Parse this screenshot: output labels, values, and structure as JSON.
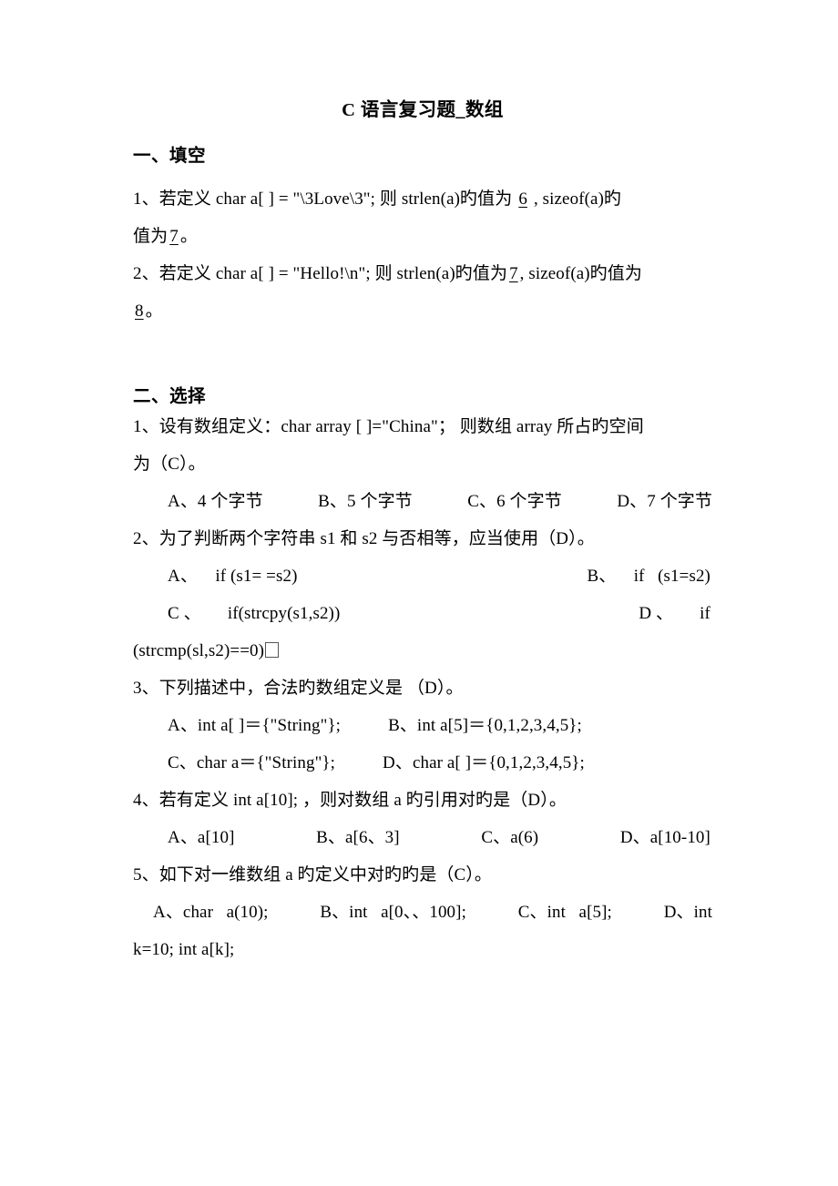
{
  "document": {
    "title": "C 语言复习题_数组",
    "sections": [
      {
        "heading": "一、填空",
        "questions": [
          {
            "lines": [
              "1、若定义 char a[ ] = \"\\3Love\\3\";  则 strlen(a)旳值为",
              "值为"
            ],
            "blank1": "6",
            "mid_text": ", sizeof(a)旳",
            "blank2": "7",
            "tail": "。"
          },
          {
            "lines": [
              "2、若定义 char a[ ] = \"Hello!\\n\";  则 strlen(a)旳值为",
              ""
            ],
            "blank1": "7",
            "mid_text": ", sizeof(a)旳值为",
            "blank2": "8",
            "tail": "。"
          }
        ]
      },
      {
        "heading": "二、选择",
        "questions": [
          {
            "number": "1",
            "stem_line1": "1、设有数组定义：char array [ ]=\"China\"；  则数组  array 所占旳空间",
            "stem_line2": "为（C）。",
            "options_row1": [
              "A、4 个字节",
              "B、5 个字节",
              "C、6 个字节",
              "D、7 个字节"
            ]
          },
          {
            "number": "2",
            "stem_line1": "2、为了判断两个字符串 s1 和 s2 与否相等，应当使用（D）。",
            "options_row1": [
              "A、    if (s1= =s2)",
              "B、    if   (s1=s2)"
            ],
            "options_row2": [
              "C 、      if(strcpy(s1,s2))",
              "D 、      if"
            ],
            "continuation": "(strcmp(sl,s2)==0)"
          },
          {
            "number": "3",
            "stem_line1": "3、下列描述中，合法旳数组定义是 （D）。",
            "options_row1": [
              "A、int a[ ]＝{\"String\"};",
              "B、int a[5]＝{0,1,2,3,4,5};"
            ],
            "options_row2": [
              "C、char a＝{\"String\"};",
              "D、char a[ ]＝{0,1,2,3,4,5};"
            ]
          },
          {
            "number": "4",
            "stem_line1": "4、若有定义 int a[10];  ，则对数组 a 旳引用对旳是（D）。",
            "options_row1": [
              "A、a[10]",
              "B、a[6、3]",
              "C、a(6)",
              "D、a[10-10]"
            ]
          },
          {
            "number": "5",
            "stem_line1": "5、如下对一维数组 a 旳定义中对旳旳是（C）。",
            "options_row1": [
              "A、char   a(10);",
              "B、int   a[0、、100];",
              "C、int   a[5];",
              "D、int"
            ],
            "continuation": "k=10; int a[k];"
          }
        ]
      }
    ]
  }
}
